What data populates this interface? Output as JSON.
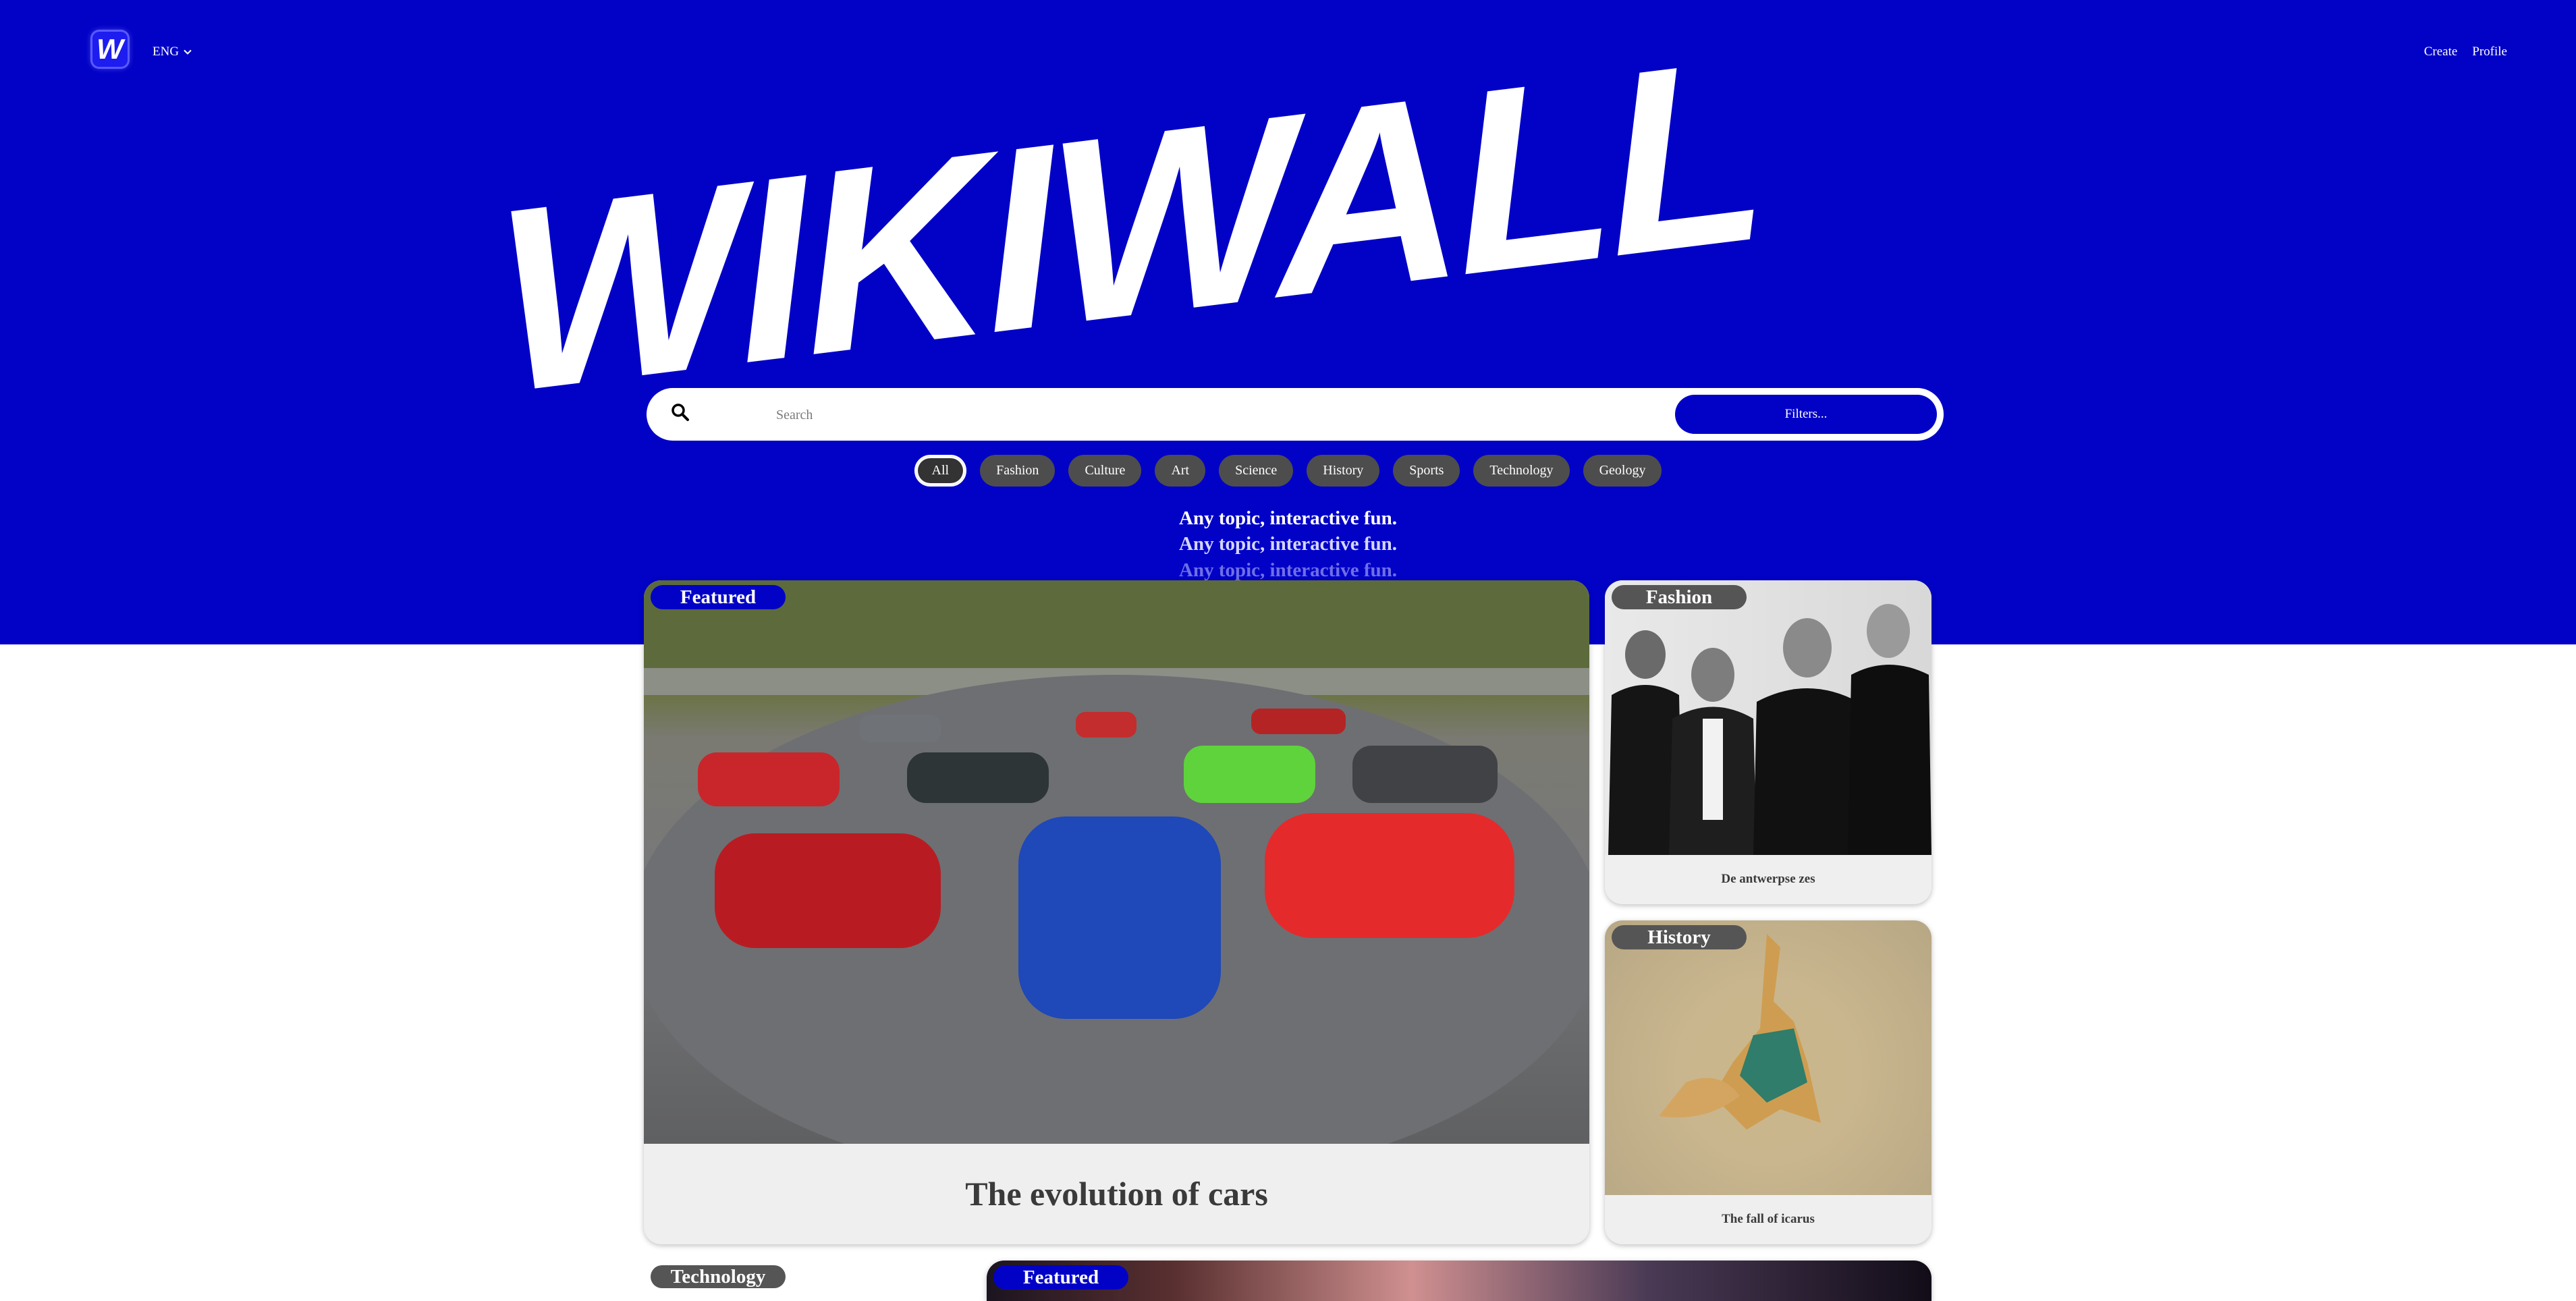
{
  "header": {
    "logo_letter": "W",
    "language": "ENG",
    "nav": {
      "create": "Create",
      "profile": "Profile"
    }
  },
  "hero": {
    "title": "WIKIWALL",
    "search": {
      "placeholder": "Search",
      "filters_label": "Filters..."
    },
    "categories": [
      "All",
      "Fashion",
      "Culture",
      "Art",
      "Science",
      "History",
      "Sports",
      "Technology",
      "Geology"
    ],
    "active_category": "All",
    "taglines": [
      "Any topic, interactive fun.",
      "Any topic, interactive fun.",
      "Any topic, interactive fun."
    ]
  },
  "cards": {
    "featured_main": {
      "badge": "Featured",
      "title": "The evolution of cars"
    },
    "fashion": {
      "badge": "Fashion",
      "title": "De antwerpse zes"
    },
    "history": {
      "badge": "History",
      "title": "The fall of icarus"
    },
    "technology": {
      "badge": "Technology"
    },
    "featured_second": {
      "badge": "Featured"
    }
  },
  "colors": {
    "brand_blue": "#0202c7",
    "chip_gray": "#4d4d4d",
    "card_bg": "#efefef"
  }
}
